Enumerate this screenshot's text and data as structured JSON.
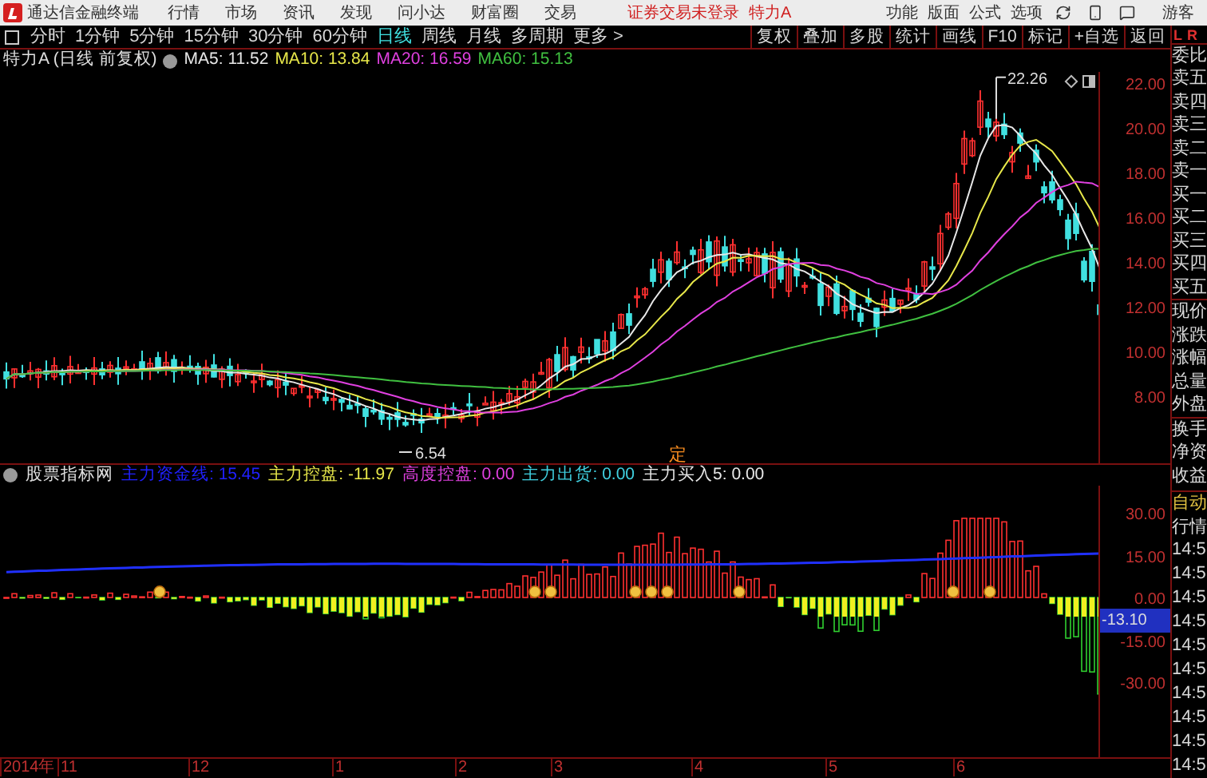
{
  "app": {
    "title": "通达信金融终端",
    "menu": [
      "行情",
      "市场",
      "资讯",
      "发现",
      "问小达",
      "财富圈",
      "交易"
    ],
    "login_status": "证券交易未登录",
    "stock_name": "特力A",
    "right_menu": [
      "功能",
      "版面",
      "公式",
      "选项"
    ],
    "user": "游客"
  },
  "periods": [
    {
      "label": "分时",
      "selected": false
    },
    {
      "label": "1分钟",
      "selected": false
    },
    {
      "label": "5分钟",
      "selected": false
    },
    {
      "label": "15分钟",
      "selected": false
    },
    {
      "label": "30分钟",
      "selected": false
    },
    {
      "label": "60分钟",
      "selected": false
    },
    {
      "label": "日线",
      "selected": true
    },
    {
      "label": "周线",
      "selected": false
    },
    {
      "label": "月线",
      "selected": false
    },
    {
      "label": "多周期",
      "selected": false
    },
    {
      "label": "更多 >",
      "selected": false
    }
  ],
  "tools": [
    "复权",
    "叠加",
    "多股",
    "统计",
    "画线",
    "F10",
    "标记",
    "+自选",
    "返回"
  ],
  "chart_info": {
    "title": "特力A (日线 前复权)",
    "ma": [
      {
        "label": "MA5: 11.52",
        "color": "#e8e8e8"
      },
      {
        "label": "MA10: 13.84",
        "color": "#e8e84a"
      },
      {
        "label": "MA20: 16.59",
        "color": "#e040e0"
      },
      {
        "label": "MA60: 15.13",
        "color": "#40c040"
      }
    ]
  },
  "price_chart": {
    "high_label": "22.26",
    "low_label": "6.54",
    "marker": "定",
    "price_ticks": [
      "22.00",
      "20.00",
      "18.00",
      "16.00",
      "14.00",
      "12.00",
      "10.00",
      "8.00"
    ]
  },
  "indicator": {
    "name": "股票指标网",
    "values": [
      {
        "label": "主力资金线: 15.45",
        "color": "#2020ff"
      },
      {
        "label": "主力控盘: -11.97",
        "color": "#e8e84a"
      },
      {
        "label": "高度控盘: 0.00",
        "color": "#e040e0"
      },
      {
        "label": "主力出货: 0.00",
        "color": "#40d0e0"
      },
      {
        "label": "主力买入5: 0.00",
        "color": "#e8e8e8"
      }
    ],
    "ticks": [
      "30.00",
      "15.00",
      "0.00",
      "-15.00",
      "-30.00"
    ],
    "current": "-13.10"
  },
  "date_axis": [
    "2014年",
    "11",
    "12",
    "1",
    "2",
    "3",
    "4",
    "5",
    "6"
  ],
  "quote_panel": {
    "tabs": [
      "L",
      "R"
    ],
    "labels": [
      "委比",
      "卖五",
      "卖四",
      "卖三",
      "卖二",
      "卖一",
      "买一",
      "买二",
      "买三",
      "买四",
      "买五",
      "现价",
      "涨跌",
      "涨幅",
      "总量",
      "外盘",
      "换手",
      "净资",
      "收益"
    ],
    "ticks_header": [
      "自动",
      "行情"
    ],
    "times": [
      "14:5",
      "14:5",
      "14:5",
      "14:5",
      "14:5",
      "14:5",
      "14:5",
      "14:5",
      "14:5",
      "14:5"
    ]
  }
}
